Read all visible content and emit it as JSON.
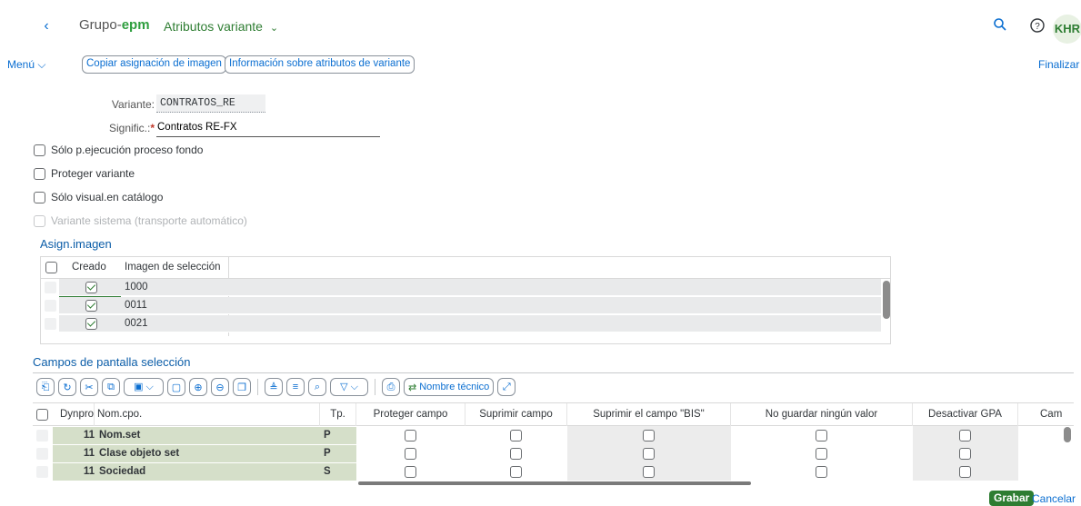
{
  "shell": {
    "back_glyph": "‹",
    "logo_prefix": "Grupo-",
    "logo_brand": "epm",
    "app_title": "Atributos variante",
    "title_chevron": "⌄",
    "avatar": "KHR"
  },
  "toolbar": {
    "menu_label": "Menú",
    "menu_chevron": "⌵",
    "buttons": [
      "Copiar asignación de imagen",
      "Información sobre atributos de variante"
    ],
    "finalize": "Finalizar"
  },
  "form": {
    "variant_label": "Variante:",
    "variant_value": "CONTRATOS_RE",
    "meaning_label": "Signific.:",
    "required_star": "*",
    "meaning_value": "Contratos RE-FX",
    "checkboxes": [
      {
        "label": "Sólo p.ejecución proceso fondo",
        "disabled": false
      },
      {
        "label": "Proteger variante",
        "disabled": false
      },
      {
        "label": "Sólo visual.en catálogo",
        "disabled": false
      },
      {
        "label": "Variante sistema (transporte automático)",
        "disabled": true
      }
    ]
  },
  "image_assign": {
    "title": "Asign.imagen",
    "columns": [
      "Creado",
      "Imagen de selección"
    ],
    "rows": [
      {
        "created": true,
        "image": "1000"
      },
      {
        "created": true,
        "image": "0011"
      },
      {
        "created": true,
        "image": "0021"
      }
    ]
  },
  "screen_fields": {
    "title": "Campos de pantalla selección",
    "technical_name_button": "Nombre técnico",
    "columns": [
      "Dynpro",
      "Nom.cpo.",
      "Tp.",
      "Proteger campo",
      "Suprimir campo",
      "Suprimir el campo \"BIS\"",
      "No guardar ningún valor",
      "Desactivar GPA",
      "Cam"
    ],
    "rows": [
      {
        "dynpro": "11",
        "name": "Nom.set",
        "type": "P"
      },
      {
        "dynpro": "11",
        "name": "Clase objeto set",
        "type": "P"
      },
      {
        "dynpro": "11",
        "name": "Sociedad",
        "type": "S"
      }
    ]
  },
  "footer": {
    "save": "Grabar",
    "cancel": "Cancelar"
  },
  "colors": {
    "accent_blue": "#0a6ed1",
    "brand_green": "#2e7d32",
    "row_green": "#d5dfc9"
  }
}
